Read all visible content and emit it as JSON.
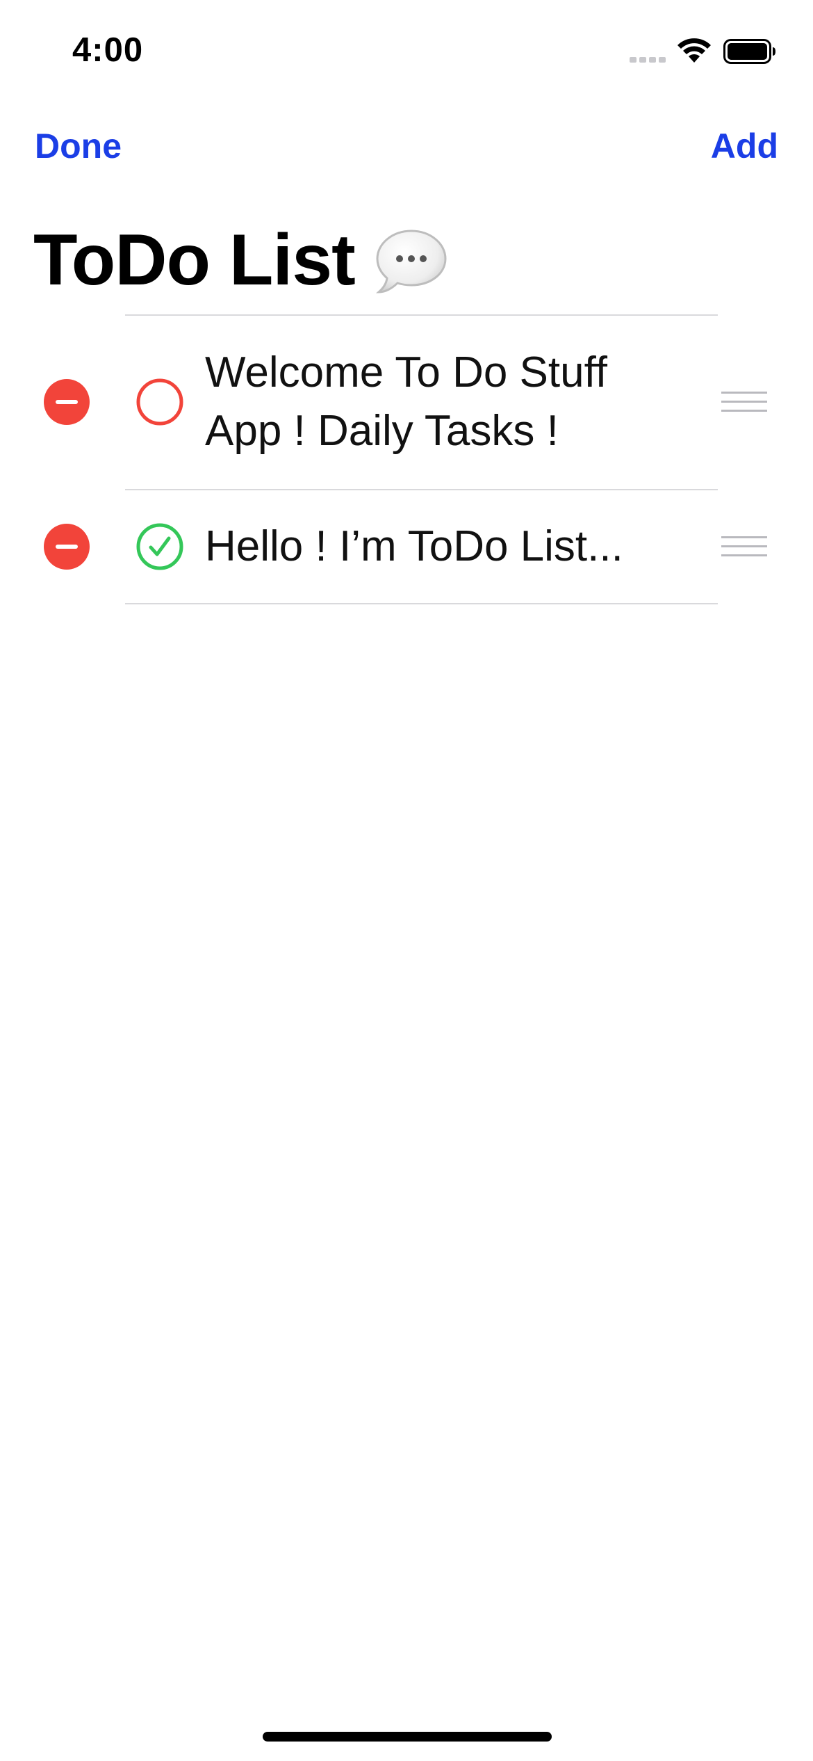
{
  "status_bar": {
    "time": "4:00",
    "icons": [
      "cellular-signal-icon",
      "wifi-icon",
      "battery-icon"
    ]
  },
  "nav": {
    "left_label": "Done",
    "right_label": "Add",
    "accent_color": "#1b3ee6"
  },
  "title": {
    "text": "ToDo List",
    "emoji_icon": "speech-bubble-icon"
  },
  "items": [
    {
      "text": "Welcome To Do Stuff App ! Daily Tasks !",
      "completed": false
    },
    {
      "text": "Hello ! I’m ToDo List...",
      "completed": true
    }
  ],
  "colors": {
    "delete": "#f2443a",
    "incomplete": "#f2443a",
    "complete": "#34c759",
    "divider": "#d9d9dc"
  }
}
